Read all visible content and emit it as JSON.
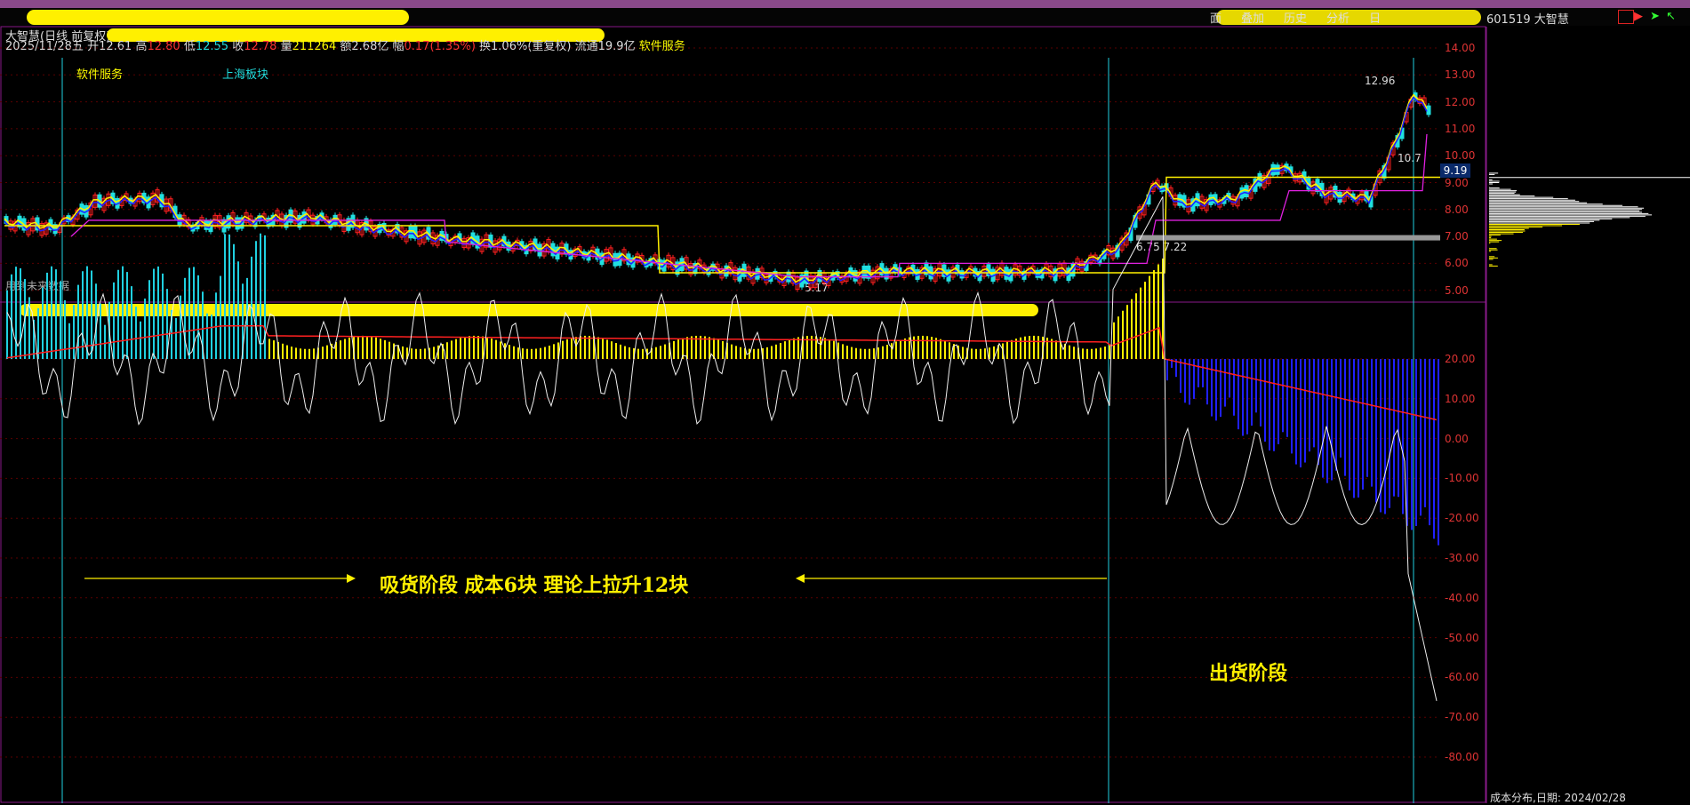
{
  "window": {
    "stock_code_name": "601519 大智慧",
    "chip_dist_label": "成本分布,日期: 2024/02/28"
  },
  "menu": {
    "tabs": [
      "面",
      "叠加",
      "历史",
      "分析",
      "",
      "",
      "",
      "日"
    ]
  },
  "header": {
    "title": "大智慧(日线 前复权)",
    "date": "2025/11/28五",
    "open_label": "开",
    "open": "12.61",
    "high_label": "高",
    "high": "12.80",
    "low_label": "低",
    "low": "12.55",
    "close_label": "收",
    "close": "12.78",
    "volume_label": "量",
    "volume": "211264",
    "amount_label": "额",
    "amount": "2.68亿",
    "change_label": "幅",
    "change": "0.17(1.35%)",
    "turnover": "换1.06%(重复权)",
    "float": "流通19.9亿",
    "sector": "软件服务"
  },
  "chart_labels": {
    "sector1": "软件服务",
    "sector2": "上海板块",
    "future_data": "用到未来数据",
    "high_mark": "12.96",
    "low_mark": "5.17",
    "mid_mark": "6.75 7.22",
    "right_mark": "10.7",
    "price_now": "9.19"
  },
  "annotations": {
    "accumulation": "吸货阶段    成本6块    理论上拉升12块",
    "distribution": "出货阶段"
  },
  "price_axis": [
    "14.00",
    "13.00",
    "12.00",
    "11.00",
    "10.00",
    "9.00",
    "8.00",
    "7.00",
    "6.00",
    "5.00"
  ],
  "ind_axis": [
    "20.00",
    "10.00",
    "0.00",
    "-10.00",
    "-20.00",
    "-30.00",
    "-40.00",
    "-50.00",
    "-60.00",
    "-70.00",
    "-80.00"
  ],
  "colors": {
    "up": "#ff2020",
    "down": "#20e0e0",
    "yellow": "#fff000",
    "magenta": "#e020e0",
    "blue": "#2020ff",
    "red": "#ff2020",
    "white": "#ffffff",
    "cyan": "#20d0e0"
  }
}
